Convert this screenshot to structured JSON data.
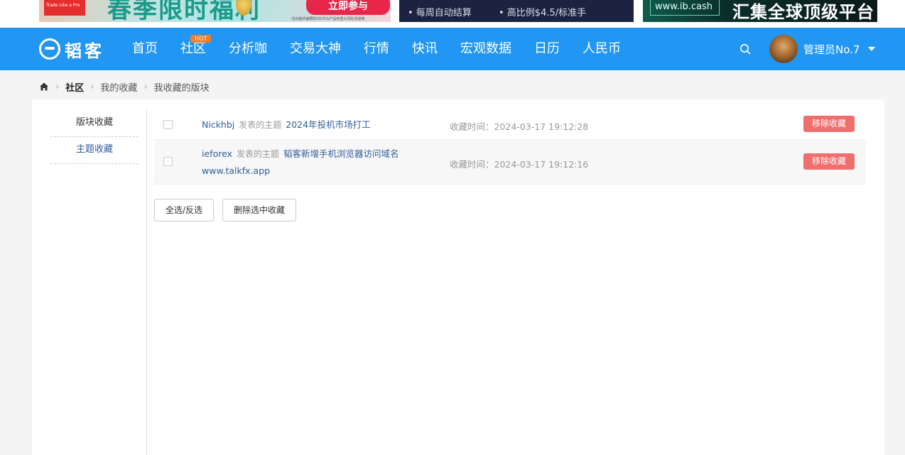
{
  "banners": {
    "b1_small": "Trade Like a Pro",
    "b1_big": "春季限时福利",
    "b1_button": "立即参与",
    "b1_tiny": "·活动最终解释权归CFDs产品有重大风险请谨慎",
    "b2_left": "• 每周自动结算",
    "b2_right": "• 高比例$4.5/标准手",
    "b3_url": "www.ib.cash",
    "b3_slogan": "汇集全球顶级平台"
  },
  "nav": {
    "logo_text": "韬客",
    "items": [
      {
        "label": "首页"
      },
      {
        "label": "社区",
        "badge": "HOT"
      },
      {
        "label": "分析咖"
      },
      {
        "label": "交易大神"
      },
      {
        "label": "行情"
      },
      {
        "label": "快讯"
      },
      {
        "label": "宏观数据"
      },
      {
        "label": "日历"
      },
      {
        "label": "人民币"
      }
    ],
    "username": "管理员No.7"
  },
  "breadcrumb": [
    "社区",
    "我的收藏",
    "我收藏的版块"
  ],
  "sidebar": {
    "items": [
      {
        "label": "版块收藏"
      },
      {
        "label": "主题收藏"
      }
    ]
  },
  "favorites": [
    {
      "author": "Nickhbj",
      "verb": "发表的主题",
      "topic": "2024年投机市场打工",
      "time": "收藏时间：2024-03-17 19:12:28",
      "remove_label": "移除收藏"
    },
    {
      "author": "ieforex",
      "verb": "发表的主题",
      "topic": "韬客新增手机浏览器访问域名www.talkfx.app",
      "time": "收藏时间：2024-03-17 19:12:16",
      "remove_label": "移除收藏"
    }
  ],
  "actions": {
    "select_all": "全选/反选",
    "delete_selected": "删除选中收藏"
  },
  "colors": {
    "nav_bg": "#2196f3",
    "remove_btn": "#ef6e6e",
    "link": "#2f5d9a",
    "hot_badge": "#ff7a1a"
  }
}
